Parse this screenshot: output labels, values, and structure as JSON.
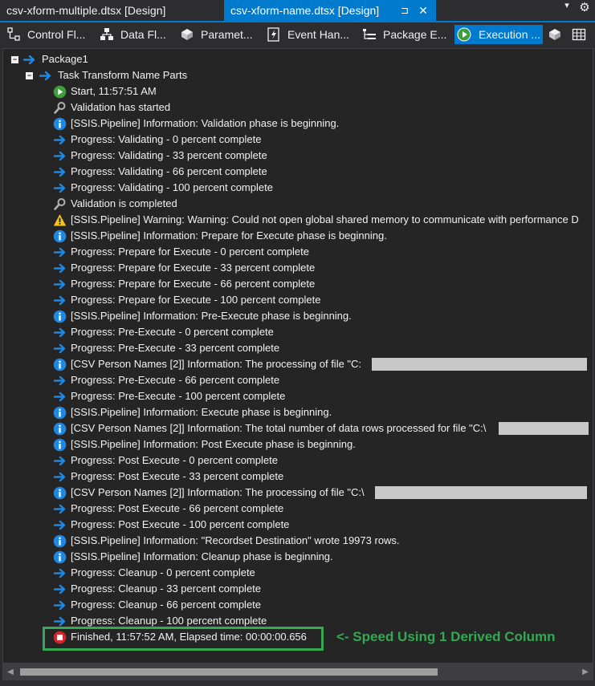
{
  "document_tabs": [
    {
      "label": "csv-xform-multiple.dtsx [Design]",
      "active": false
    },
    {
      "label": "csv-xform-name.dtsx [Design]",
      "active": true
    }
  ],
  "tab_controls": {
    "pin": "⊐",
    "close": "✕",
    "dropdown": "▾",
    "settings": "⚙"
  },
  "designer_tabs": [
    {
      "label": "Control Fl...",
      "icon": "control-flow-icon"
    },
    {
      "label": "Data Fl...",
      "icon": "data-flow-icon"
    },
    {
      "label": "Paramet...",
      "icon": "parameters-icon"
    },
    {
      "label": "Event Han...",
      "icon": "event-handlers-icon"
    },
    {
      "label": "Package E...",
      "icon": "package-explorer-icon"
    },
    {
      "label": "Execution ...",
      "icon": "execution-results-icon",
      "active": true
    }
  ],
  "tree": {
    "root": "Package1",
    "task": "Task Transform Name Parts",
    "messages": [
      {
        "icon": "start",
        "text": "Start, 11:57:51 AM"
      },
      {
        "icon": "validation",
        "text": "Validation has started"
      },
      {
        "icon": "info",
        "text": "[SSIS.Pipeline] Information: Validation phase is beginning."
      },
      {
        "icon": "progress",
        "text": "Progress: Validating - 0 percent complete"
      },
      {
        "icon": "progress",
        "text": "Progress: Validating - 33 percent complete"
      },
      {
        "icon": "progress",
        "text": "Progress: Validating - 66 percent complete"
      },
      {
        "icon": "progress",
        "text": "Progress: Validating - 100 percent complete"
      },
      {
        "icon": "validation",
        "text": "Validation is completed"
      },
      {
        "icon": "warning",
        "text": "[SSIS.Pipeline] Warning: Warning: Could not open global shared memory to communicate with performance D"
      },
      {
        "icon": "info",
        "text": "[SSIS.Pipeline] Information: Prepare for Execute phase is beginning."
      },
      {
        "icon": "progress",
        "text": "Progress: Prepare for Execute - 0 percent complete"
      },
      {
        "icon": "progress",
        "text": "Progress: Prepare for Execute - 33 percent complete"
      },
      {
        "icon": "progress",
        "text": "Progress: Prepare for Execute - 66 percent complete"
      },
      {
        "icon": "progress",
        "text": "Progress: Prepare for Execute - 100 percent complete"
      },
      {
        "icon": "info",
        "text": "[SSIS.Pipeline] Information: Pre-Execute phase is beginning."
      },
      {
        "icon": "progress",
        "text": "Progress: Pre-Execute - 0 percent complete"
      },
      {
        "icon": "progress",
        "text": "Progress: Pre-Execute - 33 percent complete"
      },
      {
        "icon": "info",
        "text": "[CSV Person Names [2]] Information: The processing of file \"C:",
        "redacted": true
      },
      {
        "icon": "progress",
        "text": "Progress: Pre-Execute - 66 percent complete"
      },
      {
        "icon": "progress",
        "text": "Progress: Pre-Execute - 100 percent complete"
      },
      {
        "icon": "info",
        "text": "[SSIS.Pipeline] Information: Execute phase is beginning."
      },
      {
        "icon": "info",
        "text": "[CSV Person Names [2]] Information: The total number of data rows processed for file \"C:\\",
        "redacted": true
      },
      {
        "icon": "info",
        "text": "[SSIS.Pipeline] Information: Post Execute phase is beginning."
      },
      {
        "icon": "progress",
        "text": "Progress: Post Execute - 0 percent complete"
      },
      {
        "icon": "progress",
        "text": "Progress: Post Execute - 33 percent complete"
      },
      {
        "icon": "info",
        "text": "[CSV Person Names [2]] Information: The processing of file \"C:\\",
        "redacted": true
      },
      {
        "icon": "progress",
        "text": "Progress: Post Execute - 66 percent complete"
      },
      {
        "icon": "progress",
        "text": "Progress: Post Execute - 100 percent complete"
      },
      {
        "icon": "info",
        "text": "[SSIS.Pipeline] Information: \"Recordset Destination\" wrote 19973 rows."
      },
      {
        "icon": "info",
        "text": "[SSIS.Pipeline] Information: Cleanup phase is beginning."
      },
      {
        "icon": "progress",
        "text": "Progress: Cleanup - 0 percent complete"
      },
      {
        "icon": "progress",
        "text": "Progress: Cleanup - 33 percent complete"
      },
      {
        "icon": "progress",
        "text": "Progress: Cleanup - 66 percent complete"
      },
      {
        "icon": "progress",
        "text": "Progress: Cleanup - 100 percent complete"
      },
      {
        "icon": "finished",
        "text": "Finished, 11:57:52 AM, Elapsed time: 00:00:00.656"
      }
    ]
  },
  "annotation": "<- Speed Using 1 Derived Column",
  "colors": {
    "accent": "#007acc",
    "background": "#252526",
    "annotation": "#34a853",
    "start_green": "#3c9e3c",
    "finished_red": "#d9242b",
    "info_blue": "#1e88e5",
    "warning_yellow": "#f5c518"
  }
}
